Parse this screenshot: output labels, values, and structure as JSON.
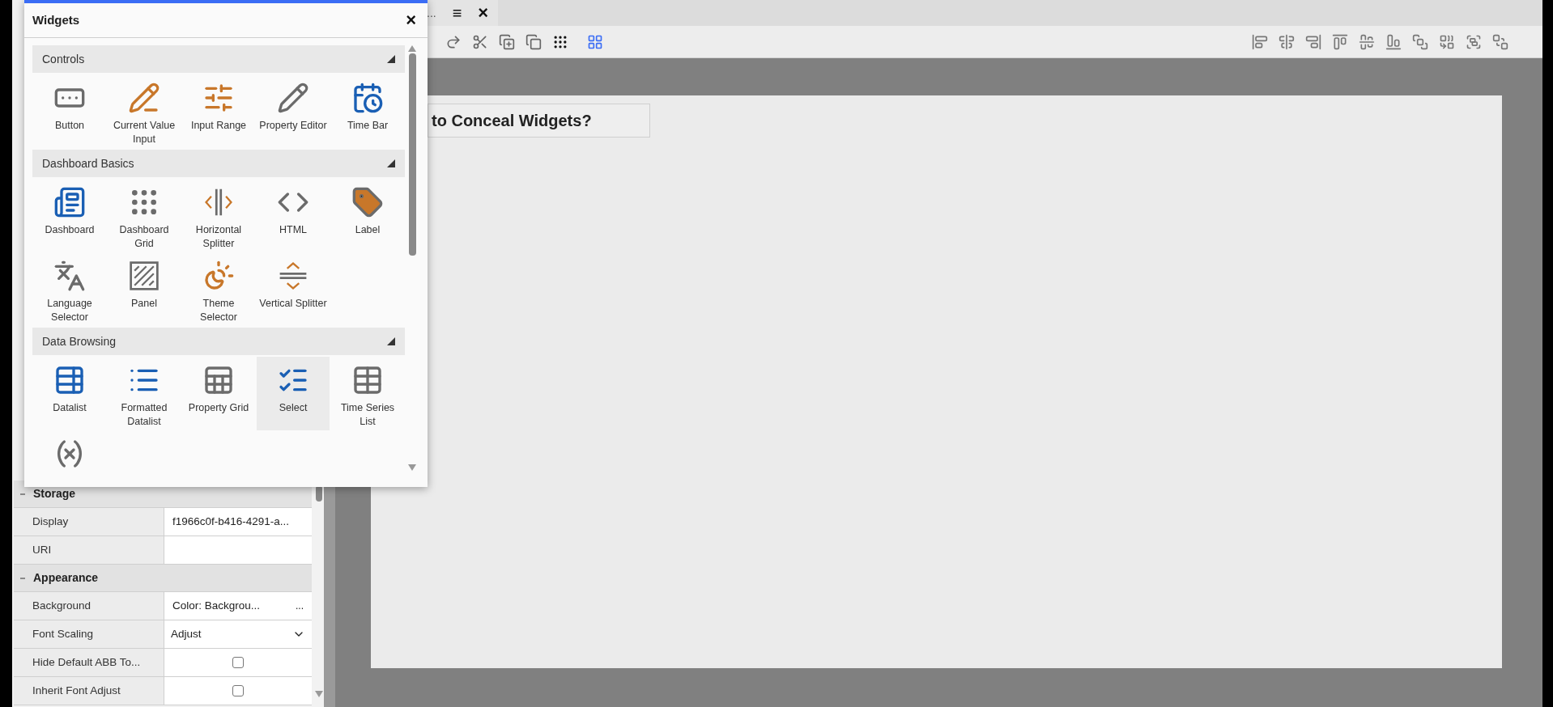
{
  "editor_tab": {
    "label": "...",
    "menu": "≡",
    "close": "×"
  },
  "canvas": {
    "title": "to Conceal Widgets?"
  },
  "widgets_dialog": {
    "title": "Widgets",
    "close": "×",
    "sections": [
      {
        "title": "Controls",
        "expanded": true,
        "items": [
          {
            "label": "Button",
            "selected": false
          },
          {
            "label": "Current Value Input",
            "selected": false
          },
          {
            "label": "Input Range",
            "selected": false
          },
          {
            "label": "Property Editor",
            "selected": false
          },
          {
            "label": "Time Bar",
            "selected": false
          }
        ]
      },
      {
        "title": "Dashboard Basics",
        "expanded": true,
        "items": [
          {
            "label": "Dashboard",
            "selected": false
          },
          {
            "label": "Dashboard Grid",
            "selected": false
          },
          {
            "label": "Horizontal Splitter",
            "selected": false
          },
          {
            "label": "HTML",
            "selected": false
          },
          {
            "label": "Label",
            "selected": false
          },
          {
            "label": "Language Selector",
            "selected": false
          },
          {
            "label": "Panel",
            "selected": false
          },
          {
            "label": "Theme Selector",
            "selected": false
          },
          {
            "label": "Vertical Splitter",
            "selected": false
          }
        ]
      },
      {
        "title": "Data Browsing",
        "expanded": true,
        "items": [
          {
            "label": "Datalist",
            "selected": false
          },
          {
            "label": "Formatted Datalist",
            "selected": false
          },
          {
            "label": "Property Grid",
            "selected": false
          },
          {
            "label": "Select",
            "selected": true
          },
          {
            "label": "Time Series List",
            "selected": false
          },
          {
            "selected": false
          }
        ]
      }
    ]
  },
  "properties": [
    {
      "kind": "section",
      "label": "Storage",
      "expanded": true
    },
    {
      "kind": "text",
      "label": "Display",
      "value": "f1966c0f-b416-4291-a..."
    },
    {
      "kind": "text",
      "label": "URI"
    },
    {
      "kind": "section",
      "label": "Appearance",
      "expanded": true
    },
    {
      "kind": "more",
      "label": "Background",
      "value": "Color: Backgrou...",
      "button": "..."
    },
    {
      "kind": "select",
      "label": "Font Scaling",
      "value": "Adjust"
    },
    {
      "kind": "checkbox",
      "label": "Hide Default ABB To...",
      "checked": false
    },
    {
      "kind": "checkbox",
      "label": "Inherit Font Adjust",
      "checked": false
    }
  ]
}
